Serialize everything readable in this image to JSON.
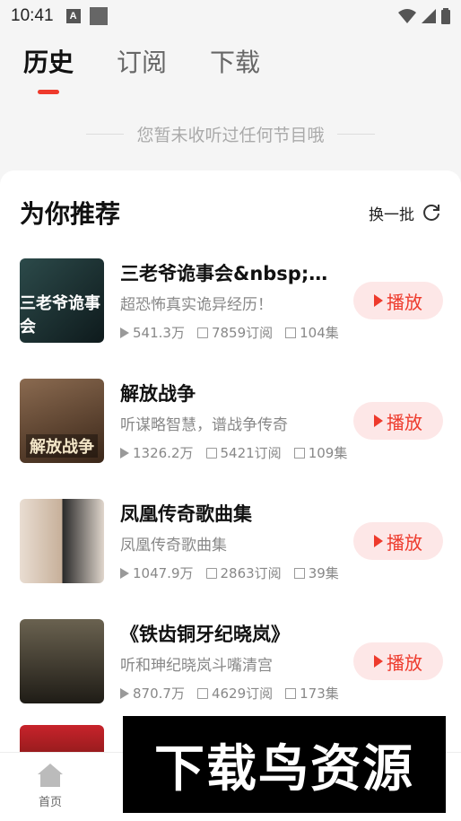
{
  "status_bar": {
    "time": "10:41"
  },
  "tabs": [
    {
      "label": "历史",
      "active": true
    },
    {
      "label": "订阅",
      "active": false
    },
    {
      "label": "下载",
      "active": false
    }
  ],
  "empty_note": "您暂未收听过任何节目哦",
  "recommend": {
    "title": "为你推荐",
    "refresh_label": "换一批",
    "play_label": "播放",
    "items": [
      {
        "title": "三老爷诡事会&nbsp;多...",
        "desc": "超恐怖真实诡异经历！",
        "plays": "541.3万",
        "subs": "7859订阅",
        "episodes": "104集",
        "cover_color": "#1e3a3a",
        "cover_text": "三老爷诡事会"
      },
      {
        "title": "解放战争",
        "desc": "听谋略智慧，谱战争传奇",
        "plays": "1326.2万",
        "subs": "5421订阅",
        "episodes": "109集",
        "cover_color": "#5a3a28",
        "cover_text": "解放战争"
      },
      {
        "title": "凤凰传奇歌曲集",
        "desc": "凤凰传奇歌曲集",
        "plays": "1047.9万",
        "subs": "2863订阅",
        "episodes": "39集",
        "cover_color": "#c9b8a8",
        "cover_text": ""
      },
      {
        "title": "《铁齿铜牙纪晓岚》",
        "desc": "听和珅纪晓岚斗嘴清宫",
        "plays": "870.7万",
        "subs": "4629订阅",
        "episodes": "173集",
        "cover_color": "#3a3a30",
        "cover_text": ""
      }
    ]
  },
  "bottom_nav": {
    "home_label": "首页"
  },
  "watermark": "下载鸟资源"
}
